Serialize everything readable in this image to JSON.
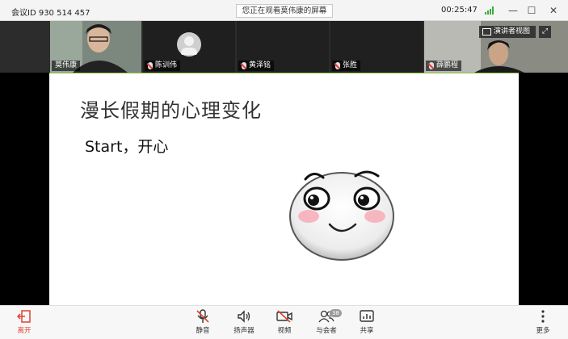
{
  "titlebar": {
    "meeting_id": "会议ID 930 514 457",
    "viewing": "您正在观看莫伟康的屏幕",
    "timer": "00:25:47",
    "signal_color": "#38b03a"
  },
  "participants": [
    {
      "name": "莫伟康",
      "muted": false
    },
    {
      "name": "陈训伟",
      "muted": true
    },
    {
      "name": "黄泽铭",
      "muted": true
    },
    {
      "name": "张胜",
      "muted": true
    },
    {
      "name": "薛鹏程",
      "muted": true
    }
  ],
  "strip": {
    "speaker_view": "演讲者视图"
  },
  "slide": {
    "title": "漫长假期的心理变化",
    "subtitle": "Start，开心"
  },
  "toolbar": {
    "leave": "离开",
    "mute": "静音",
    "speaker": "扬声器",
    "video": "视频",
    "participants": "与会者",
    "participants_count": "38",
    "share": "共享",
    "more": "更多",
    "leave_color": "#e0412f"
  }
}
